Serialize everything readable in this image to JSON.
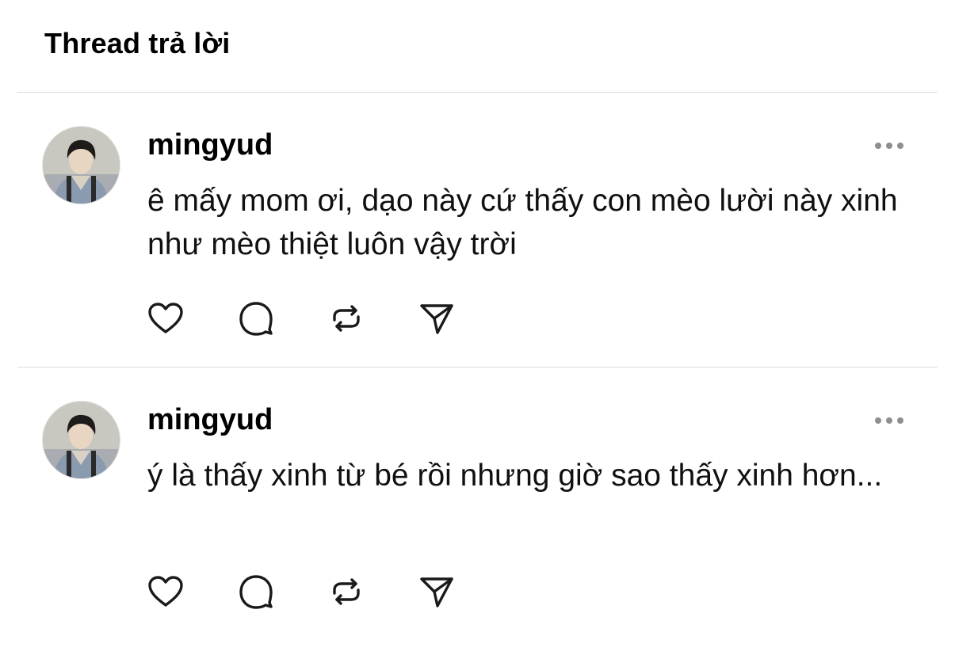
{
  "header": {
    "title": "Thread trả lời"
  },
  "posts": [
    {
      "username": "mingyud",
      "text": "ê mấy mom ơi, dạo này cứ thấy con mèo lười này xinh như mèo thiệt luôn vậy trời",
      "actions": {
        "like": "heart-icon",
        "reply": "comment-icon",
        "repost": "repost-icon",
        "share": "send-icon"
      }
    },
    {
      "username": "mingyud",
      "text": "ý là thấy xinh từ bé rồi nhưng giờ sao thấy xinh hơn...",
      "actions": {
        "like": "heart-icon",
        "reply": "comment-icon",
        "repost": "repost-icon",
        "share": "send-icon"
      }
    }
  ],
  "colors": {
    "text": "#000000",
    "icon": "#1a1a1a",
    "divider": "#dcdcdc",
    "more_dots": "#8e8e8e"
  }
}
